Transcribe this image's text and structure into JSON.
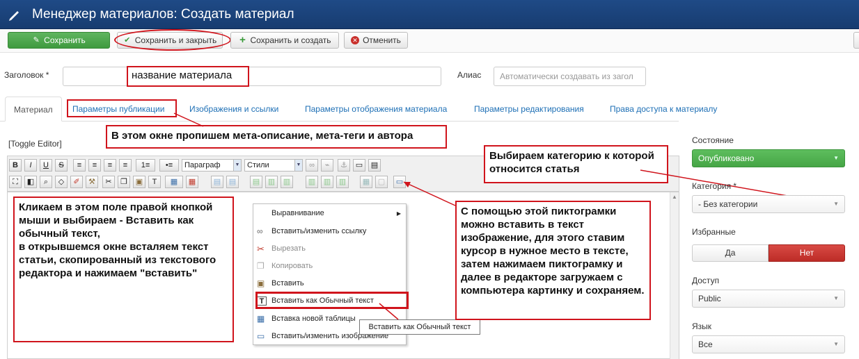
{
  "header": {
    "title": "Менеджер материалов: Создать материал"
  },
  "toolbar": {
    "save": "Сохранить",
    "save_close": "Сохранить и закрыть",
    "save_new": "Сохранить и создать",
    "cancel": "Отменить"
  },
  "form": {
    "title_label": "Заголовок *",
    "title_annotation": "название материала",
    "alias_label": "Алиас",
    "alias_placeholder": "Автоматически создавать из загол"
  },
  "tabs": [
    "Материал",
    "Параметры публикации",
    "Изображения и ссылки",
    "Параметры отображения материала",
    "Параметры редактирования",
    "Права доступа к материалу"
  ],
  "annotations": {
    "publication": "В этом окне пропишем мета-описание, мета-теги и автора",
    "category": "Выбираем категорию к которой относится статья",
    "editor": "Кликаем в этом поле правой кнопкой мыши и выбираем - Вставить как обычный текст,\nв открывшемся окне всталяем текст статьи, скопированный из текстового редактора и нажимаем \"вставить\"",
    "image": "С помощью этой пиктограмки можно вставить в текст изображение, для этого ставим курсор в нужное место в тексте, затем нажимаем пиктограмку и далее в редакторе загружаем с компьютера картинку и сохраняем."
  },
  "editor": {
    "toggle": "[Toggle Editor]",
    "format_select": "Параграф",
    "styles_select": "Стили"
  },
  "context_menu": {
    "items": [
      {
        "label": "Выравнивание",
        "icon": "none"
      },
      {
        "label": "Вставить/изменить ссылку",
        "icon": "link-icon"
      },
      {
        "label": "Вырезать",
        "icon": "cut-icon"
      },
      {
        "label": "Копировать",
        "icon": "copy-icon"
      },
      {
        "label": "Вставить",
        "icon": "paste-icon"
      },
      {
        "label": "Вставить как Обычный текст",
        "icon": "paste-text-icon"
      },
      {
        "label": "Вставка новой таблицы",
        "icon": "table-icon"
      },
      {
        "label": "Вставить/изменить изображение",
        "icon": "image-icon"
      }
    ],
    "tooltip": "Вставить как Обычный текст"
  },
  "sidebar": {
    "state_label": "Состояние",
    "state_value": "Опубликовано",
    "category_label": "Категория *",
    "category_value": "- Без категории",
    "featured_label": "Избранные",
    "featured_yes": "Да",
    "featured_no": "Нет",
    "access_label": "Доступ",
    "access_value": "Public",
    "language_label": "Язык",
    "language_value": "Все"
  },
  "colors": {
    "header": "#1f4a86",
    "accent_red": "#d0141c",
    "green": "#4aa84a",
    "link": "#1d6fb5"
  }
}
